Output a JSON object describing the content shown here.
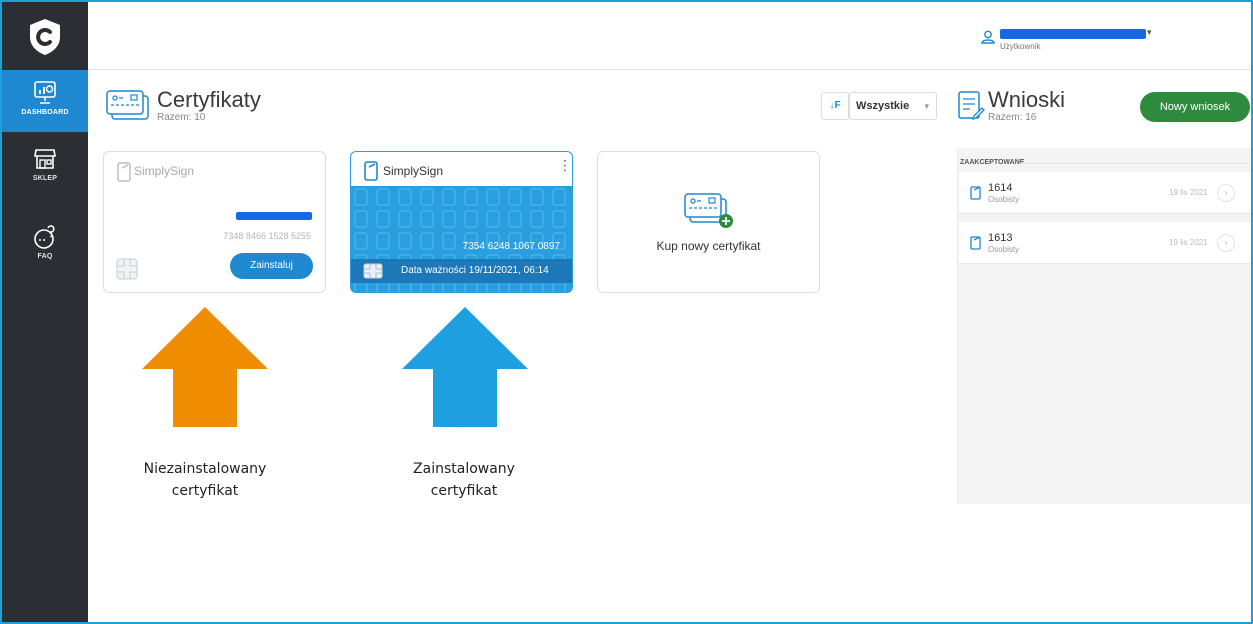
{
  "sidebar": {
    "items": [
      {
        "label": "DASHBOARD",
        "icon": "dashboard-icon",
        "active": true
      },
      {
        "label": "SKLEP",
        "icon": "shop-icon",
        "active": false
      },
      {
        "label": "FAQ",
        "icon": "faq-icon",
        "active": false
      }
    ]
  },
  "header": {
    "user_role": "Użytkownik"
  },
  "certificates": {
    "title": "Certyfikaty",
    "total": "Razem: 10",
    "sort_icon": "↓F",
    "filter_value": "Wszystkie",
    "cards": [
      {
        "brand": "SimplySign",
        "serial": "7348 8466 1528 5255",
        "install_label": "Zainstaluj",
        "installed": false
      },
      {
        "brand": "SimplySign",
        "serial": "7354 6248 1067 0897",
        "expiry": "Data ważności 19/11/2021, 06:14",
        "installed": true
      }
    ],
    "buy_label": "Kup nowy certyfikat"
  },
  "requests": {
    "title": "Wnioski",
    "total": "Razem: 16",
    "new_button": "Nowy wniosek",
    "group_label": "ZAAKCEPTOWANE",
    "items": [
      {
        "number": "1614",
        "type": "Osobisty",
        "date": "19 lis 2021"
      },
      {
        "number": "1613",
        "type": "Osobisty",
        "date": "19 lis 2021"
      }
    ]
  },
  "annotations": {
    "left": [
      "Niezainstalowany",
      "certyfikat"
    ],
    "right": [
      "Zainstalowany",
      "certyfikat"
    ]
  },
  "colors": {
    "sidebar": "#2b2f33",
    "accent_blue": "#1e88d0",
    "card_blue": "#2a9fe0",
    "green": "#2e8b3e",
    "arrow_orange": "#f08c00",
    "arrow_blue": "#1ea0e0"
  }
}
